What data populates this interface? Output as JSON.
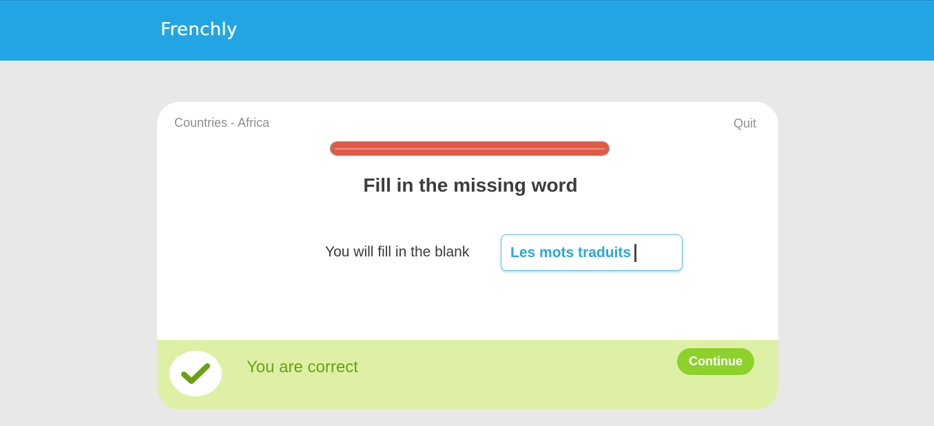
{
  "app": {
    "name": "Frenchly",
    "header_color": "#22a5e5"
  },
  "lesson": {
    "title": "Countries - Africa",
    "quit_label": "Quit",
    "progress_fraction": 1.0,
    "progress_color": "#e05a47"
  },
  "exercise": {
    "instruction": "Fill in the missing word",
    "prompt": "You will fill in the blank",
    "answer_value": "Les mots traduits"
  },
  "feedback": {
    "message": "You are correct",
    "icon": "checkmark-icon",
    "continue_label": "Continue",
    "success_color": "#8cd22a",
    "panel_color": "#def0a6"
  }
}
